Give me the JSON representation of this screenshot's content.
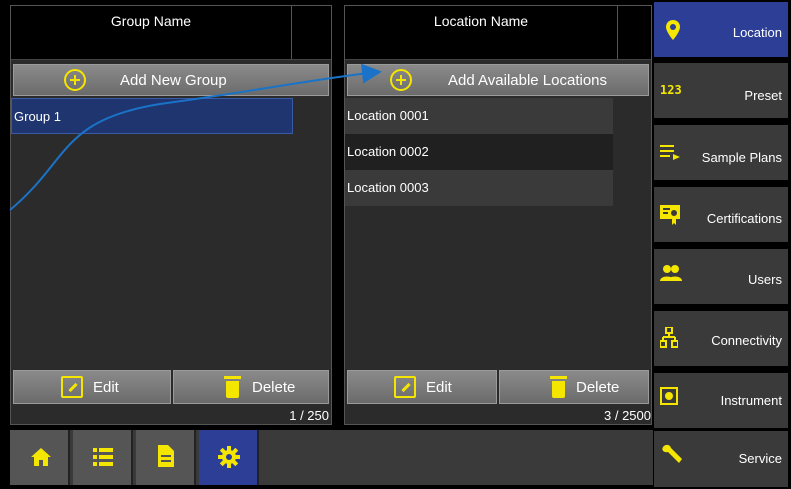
{
  "groups_panel": {
    "header": "Group Name",
    "add_label": "Add New Group",
    "items": [
      "Group 1"
    ],
    "edit_label": "Edit",
    "delete_label": "Delete",
    "counter": "1 / 250"
  },
  "locations_panel": {
    "header": "Location Name",
    "add_label": "Add Available Locations",
    "items": [
      "Location 0001",
      "Location 0002",
      "Location 0003"
    ],
    "edit_label": "Edit",
    "delete_label": "Delete",
    "counter": "3 / 2500"
  },
  "bottom_nav": [
    {
      "icon": "home-icon",
      "active": false
    },
    {
      "icon": "list-icon",
      "active": false
    },
    {
      "icon": "document-icon",
      "active": false
    },
    {
      "icon": "gear-icon",
      "active": true
    }
  ],
  "sidebar": {
    "items": [
      {
        "label": "Location",
        "icon": "map-pin-icon",
        "active": true
      },
      {
        "label": "Preset",
        "icon": "123-icon",
        "glyph": "123",
        "active": false
      },
      {
        "label": "Sample Plans",
        "icon": "playlist-icon",
        "active": false
      },
      {
        "label": "Certifications",
        "icon": "certificate-icon",
        "active": false
      },
      {
        "label": "Users",
        "icon": "users-icon",
        "active": false
      },
      {
        "label": "Connectivity",
        "icon": "network-icon",
        "active": false
      },
      {
        "label": "Instrument",
        "icon": "instrument-icon",
        "active": false
      },
      {
        "label": "Service",
        "icon": "wrench-icon",
        "active": false
      }
    ]
  },
  "colors": {
    "accent": "#f5e600",
    "active_blue": "#2c3e96",
    "selected_row": "#1f3570",
    "annotation_arrow": "#1a73c8"
  }
}
